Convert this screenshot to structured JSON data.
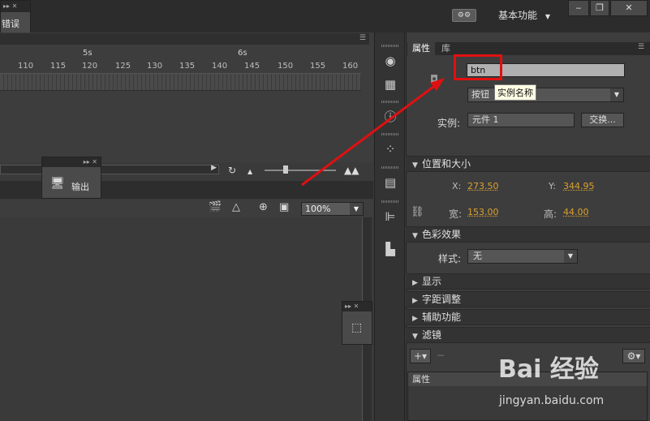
{
  "top": {
    "error_panel_label": "错误",
    "sync_icon": "sync-settings-icon",
    "workspace_label": "基本功能",
    "min": "‒",
    "max": "❐",
    "close": "✕"
  },
  "timeline": {
    "markers": [
      "5s",
      "6s"
    ],
    "ruler": [
      "110",
      "115",
      "120",
      "125",
      "130",
      "135",
      "140",
      "145",
      "150",
      "155",
      "160"
    ]
  },
  "stage": {
    "zoom": "100%"
  },
  "output_panel": {
    "label": "输出"
  },
  "props": {
    "tab_properties": "属性",
    "tab_library": "库",
    "instance_name": "btn",
    "tooltip": "实例名称",
    "symbol_type": "按钮",
    "instance_label": "实例:",
    "instance_value": "元件 1",
    "swap_label": "交换...",
    "section_position": "位置和大小",
    "x_label": "X:",
    "x_value": "273.50",
    "y_label": "Y:",
    "y_value": "344.95",
    "w_label": "宽:",
    "w_value": "153.00",
    "h_label": "高:",
    "h_value": "44.00",
    "section_color": "色彩效果",
    "style_label": "样式:",
    "style_value": "无",
    "section_display": "显示",
    "section_kerning": "字距调整",
    "section_accessibility": "辅助功能",
    "section_filters": "滤镜",
    "filter_col": "属性"
  },
  "watermark": {
    "logo": "Bai 经验",
    "url": "jingyan.baidu.com"
  },
  "colors": {
    "accent_value": "#d9a030",
    "highlight": "#e01010"
  }
}
